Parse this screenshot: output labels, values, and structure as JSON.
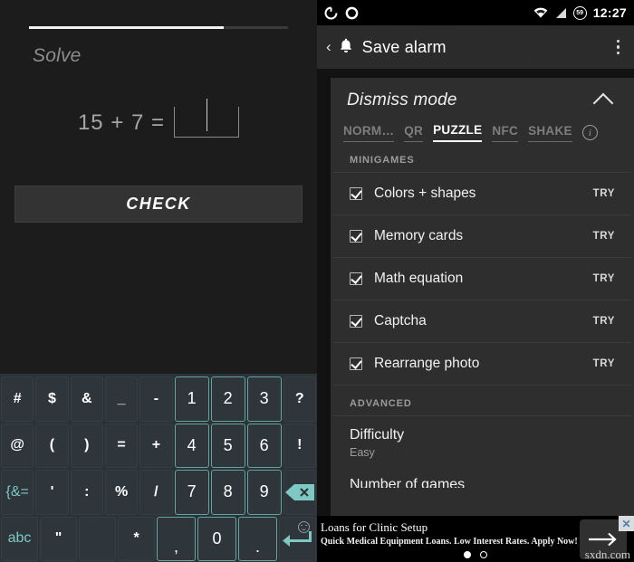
{
  "left_panel": {
    "progress_percent": 75,
    "solve_label": "Solve",
    "equation": "15 + 7 =",
    "answer_value": "",
    "check_label": "CHECK",
    "keyboard": {
      "rows": [
        [
          {
            "label": "#",
            "type": "sym"
          },
          {
            "label": "$",
            "type": "sym"
          },
          {
            "label": "&",
            "type": "sym"
          },
          {
            "label": "_",
            "type": "sym"
          },
          {
            "label": "-",
            "type": "sym"
          },
          {
            "label": "1",
            "type": "num"
          },
          {
            "label": "2",
            "type": "num"
          },
          {
            "label": "3",
            "type": "num"
          },
          {
            "label": "?",
            "type": "sym"
          }
        ],
        [
          {
            "label": "@",
            "type": "sym"
          },
          {
            "label": "(",
            "type": "sym"
          },
          {
            "label": ")",
            "type": "sym"
          },
          {
            "label": "=",
            "type": "sym"
          },
          {
            "label": "+",
            "type": "sym"
          },
          {
            "label": "4",
            "type": "num"
          },
          {
            "label": "5",
            "type": "num"
          },
          {
            "label": "6",
            "type": "num"
          },
          {
            "label": "!",
            "type": "sym"
          }
        ],
        [
          {
            "label": "{&=",
            "type": "teal"
          },
          {
            "label": "'",
            "type": "sym"
          },
          {
            "label": ":",
            "type": "sym"
          },
          {
            "label": "%",
            "type": "sym"
          },
          {
            "label": "/",
            "type": "sym"
          },
          {
            "label": "7",
            "type": "num"
          },
          {
            "label": "8",
            "type": "num"
          },
          {
            "label": "9",
            "type": "num"
          },
          {
            "label": "",
            "type": "backspace",
            "icon": "backspace-icon"
          }
        ],
        [
          {
            "label": "abc",
            "type": "teal"
          },
          {
            "label": "\"",
            "type": "sym"
          },
          {
            "label": "",
            "type": "blank"
          },
          {
            "label": "*",
            "type": "sym"
          },
          {
            "label": ",",
            "type": "num"
          },
          {
            "label": "0",
            "type": "num"
          },
          {
            "label": ".",
            "type": "num"
          },
          {
            "label": "",
            "type": "enter",
            "icon": "enter-icon"
          }
        ]
      ]
    }
  },
  "right_panel": {
    "statusbar": {
      "notification_icons": [
        "spinner-notification-icon",
        "circle-notification-icon"
      ],
      "wifi_icon": "wifi-icon",
      "signal_icon": "signal-icon",
      "battery_level": "59",
      "time": "12:27"
    },
    "actionbar": {
      "back_icon": "back-chevron-icon",
      "alarm_icon": "alarm-bell-icon",
      "title": "Save alarm",
      "overflow_icon": "overflow-menu-icon"
    },
    "card": {
      "title": "Dismiss mode",
      "collapse_icon": "chevron-up-icon",
      "tabs": [
        {
          "label": "NORM…",
          "active": false
        },
        {
          "label": "QR",
          "active": false
        },
        {
          "label": "PUZZLE",
          "active": true
        },
        {
          "label": "NFC",
          "active": false
        },
        {
          "label": "SHAKE",
          "active": false
        }
      ],
      "info_icon_label": "i",
      "sections": [
        {
          "label": "MINIGAMES",
          "rows": [
            {
              "label": "Colors + shapes",
              "checked": true,
              "action": "TRY"
            },
            {
              "label": "Memory cards",
              "checked": true,
              "action": "TRY"
            },
            {
              "label": "Math equation",
              "checked": true,
              "action": "TRY"
            },
            {
              "label": "Captcha",
              "checked": true,
              "action": "TRY"
            },
            {
              "label": "Rearrange photo",
              "checked": true,
              "action": "TRY"
            }
          ]
        },
        {
          "label": "ADVANCED",
          "preferences": [
            {
              "title": "Difficulty",
              "subtitle": "Easy"
            },
            {
              "title": "Number of games",
              "subtitle": ""
            }
          ]
        }
      ]
    },
    "ad": {
      "title": "Loans for Clinic Setup",
      "subtitle": "Quick Medical Equipment Loans. Low Interest Rates. Apply Now!",
      "arrow_icon": "arrow-right-icon",
      "close_label": "✕",
      "watermark": "sxdn.com",
      "dots": [
        true,
        false
      ]
    }
  }
}
